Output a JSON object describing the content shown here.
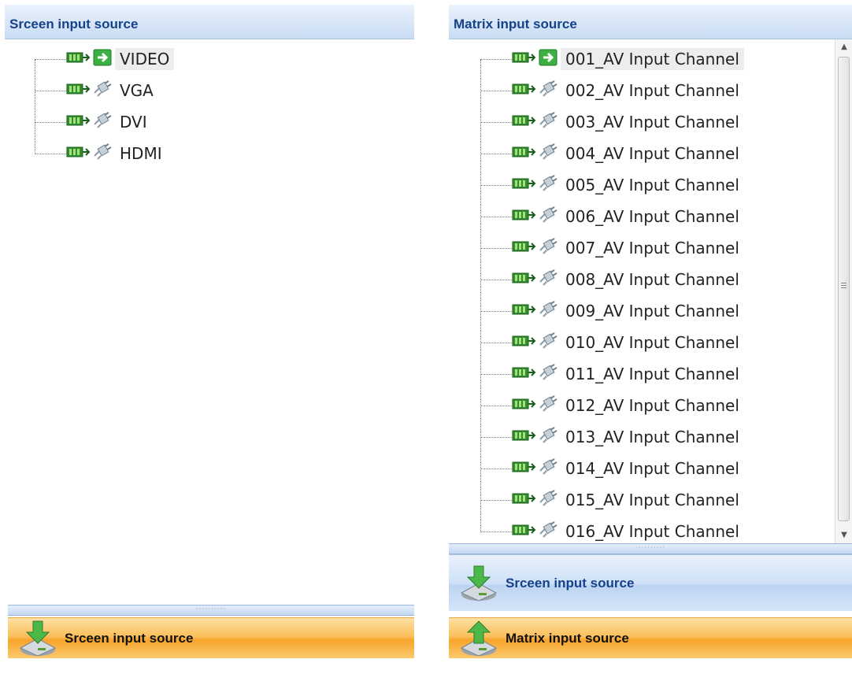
{
  "left": {
    "header": "Srceen input source",
    "items": [
      {
        "label": "VIDEO",
        "selected": true
      },
      {
        "label": "VGA",
        "selected": false
      },
      {
        "label": "DVI",
        "selected": false
      },
      {
        "label": "HDMI",
        "selected": false
      }
    ],
    "footer": "Srceen input source"
  },
  "right": {
    "header": "Matrix input source",
    "items": [
      {
        "label": "001_AV Input Channel",
        "selected": true
      },
      {
        "label": "002_AV Input Channel",
        "selected": false
      },
      {
        "label": "003_AV Input Channel",
        "selected": false
      },
      {
        "label": "004_AV Input Channel",
        "selected": false
      },
      {
        "label": "005_AV Input Channel",
        "selected": false
      },
      {
        "label": "006_AV Input Channel",
        "selected": false
      },
      {
        "label": "007_AV Input Channel",
        "selected": false
      },
      {
        "label": "008_AV Input Channel",
        "selected": false
      },
      {
        "label": "009_AV Input Channel",
        "selected": false
      },
      {
        "label": "010_AV Input Channel",
        "selected": false
      },
      {
        "label": "011_AV Input Channel",
        "selected": false
      },
      {
        "label": "012_AV Input Channel",
        "selected": false
      },
      {
        "label": "013_AV Input Channel",
        "selected": false
      },
      {
        "label": "014_AV Input Channel",
        "selected": false
      },
      {
        "label": "015_AV Input Channel",
        "selected": false
      },
      {
        "label": "016_AV Input Channel",
        "selected": false
      }
    ],
    "footer_inactive": "Srceen input source",
    "footer_active": "Matrix input source"
  },
  "icons": {
    "device": "card-icon",
    "arrow_selected": "green-arrow-icon",
    "arrow_idle": "plug-icon"
  },
  "colors": {
    "header_text": "#15428b",
    "active_button": "#f7a52d",
    "inactive_button": "#c9dcf3"
  }
}
